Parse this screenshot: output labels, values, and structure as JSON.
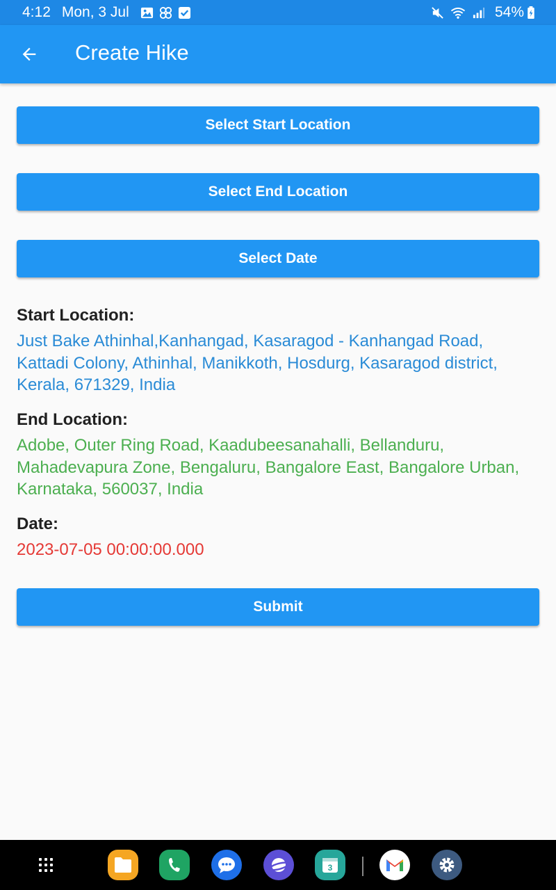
{
  "status_bar": {
    "time": "4:12",
    "date": "Mon, 3 Jul",
    "battery": "54%"
  },
  "app_bar": {
    "title": "Create Hike"
  },
  "buttons": {
    "start_location": "Select Start Location",
    "end_location": "Select End Location",
    "date": "Select Date",
    "submit": "Submit"
  },
  "details": {
    "start_label": "Start Location:",
    "start_value": "Just Bake Athinhal,Kanhangad, Kasaragod - Kanhangad Road, Kattadi Colony, Athinhal, Manikkoth, Hosdurg, Kasaragod district, Kerala, 671329, India",
    "end_label": "End Location:",
    "end_value": "Adobe, Outer Ring Road, Kaadubeesanahalli, Bellanduru, Mahadevapura Zone, Bengaluru, Bangalore East, Bangalore Urban, Karnataka, 560037, India",
    "date_label": "Date:",
    "date_value": "2023-07-05 00:00:00.000"
  },
  "colors": {
    "primary": "#2196f3",
    "status_bar": "#1e88e5",
    "start_text": "#2a8bd6",
    "end_text": "#4caf50",
    "date_text": "#e53935"
  },
  "nav_bar": {
    "apps": [
      {
        "name": "files-icon",
        "color": "#f5a623"
      },
      {
        "name": "phone-icon",
        "color": "#1fa463"
      },
      {
        "name": "messages-icon",
        "color": "#1e6fe8"
      },
      {
        "name": "internet-icon",
        "color": "#5c4fd6"
      },
      {
        "name": "calendar-icon",
        "color": "#26a69a",
        "badge": "3"
      },
      {
        "name": "gmail-icon",
        "color": "#ffffff"
      },
      {
        "name": "settings-icon",
        "color": "#3d5a80"
      }
    ]
  }
}
